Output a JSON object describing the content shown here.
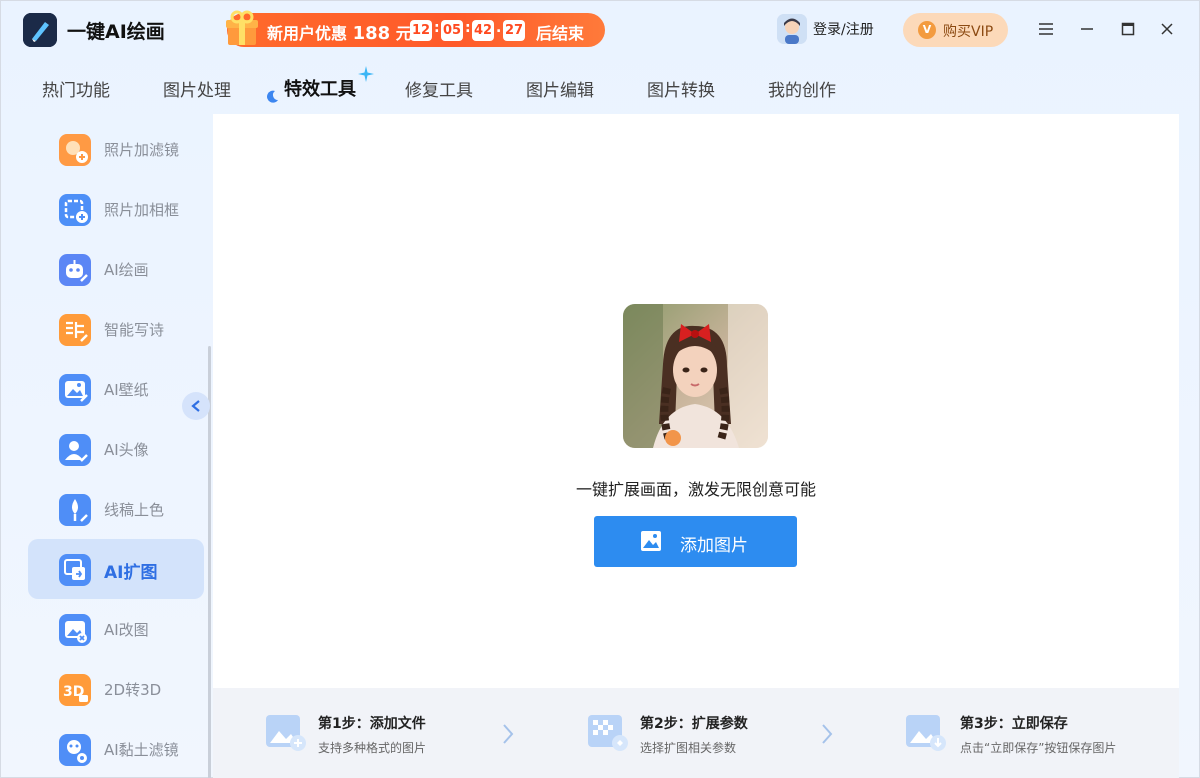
{
  "app": {
    "title": "一键AI绘画"
  },
  "promo": {
    "text_prefix": "新用户优惠",
    "amount": "188",
    "unit": "元",
    "countdown": [
      "12",
      "05",
      "42",
      "27"
    ],
    "suffix": "后结束"
  },
  "header": {
    "login_label": "登录/注册",
    "vip_badge": "V",
    "vip_label": "购买VIP"
  },
  "tabs": [
    {
      "label": "热门功能",
      "active": false
    },
    {
      "label": "图片处理",
      "active": false
    },
    {
      "label": "特效工具",
      "active": true
    },
    {
      "label": "修复工具",
      "active": false
    },
    {
      "label": "图片编辑",
      "active": false
    },
    {
      "label": "图片转换",
      "active": false
    },
    {
      "label": "我的创作",
      "active": false
    }
  ],
  "sidebar": {
    "items": [
      {
        "label": "照片加滤镜",
        "icon": "photo-filter-icon",
        "color": "#ff9b45"
      },
      {
        "label": "照片加相框",
        "icon": "photo-frame-icon",
        "color": "#4d8ff7"
      },
      {
        "label": "AI绘画",
        "icon": "robot-icon",
        "color": "#5b86f5"
      },
      {
        "label": "智能写诗",
        "icon": "poem-icon",
        "color": "#ff9b3a"
      },
      {
        "label": "AI壁纸",
        "icon": "wallpaper-icon",
        "color": "#4f8ef7"
      },
      {
        "label": "AI头像",
        "icon": "avatar-icon",
        "color": "#4f8ef7"
      },
      {
        "label": "线稿上色",
        "icon": "sketch-color-icon",
        "color": "#4f8ef7"
      },
      {
        "label": "AI扩图",
        "icon": "expand-image-icon",
        "color": "#4f8ef7",
        "active": true
      },
      {
        "label": "AI改图",
        "icon": "modify-image-icon",
        "color": "#4f8ef7"
      },
      {
        "label": "2D转3D",
        "icon": "2d-to-3d-icon",
        "color": "#ff9b3a"
      },
      {
        "label": "AI黏土滤镜",
        "icon": "clay-filter-icon",
        "color": "#4f8ef7"
      }
    ]
  },
  "main": {
    "tagline": "一键扩展画面，激发无限创意可能",
    "add_button": "添加图片"
  },
  "steps": [
    {
      "title": "第1步：添加文件",
      "desc": "支持多种格式的图片"
    },
    {
      "title": "第2步：扩展参数",
      "desc": "选择扩图相关参数"
    },
    {
      "title": "第3步：立即保存",
      "desc": "点击“立即保存”按钮保存图片"
    }
  ],
  "colors": {
    "accent": "#2d8cf0",
    "promo": "#ff5a2a",
    "vip_bg": "#fcd9b9",
    "active_side": "#d3e3fb"
  }
}
